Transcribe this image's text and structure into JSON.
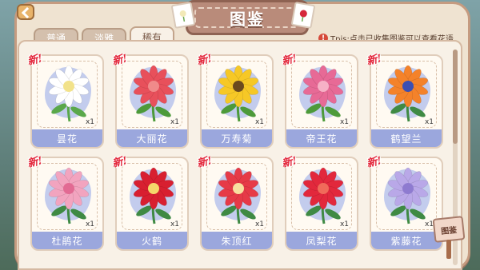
{
  "header": {
    "title": "图鉴"
  },
  "tabs": [
    {
      "label": "普通",
      "active": false
    },
    {
      "label": "淡雅",
      "active": false
    },
    {
      "label": "稀有",
      "active": true
    }
  ],
  "tip": {
    "icon": "exclamation-icon",
    "text": "Tpis:点击已收集图鉴可以查看花语"
  },
  "new_badge_text": "新!",
  "flowers": [
    {
      "name": "昙花",
      "count": "x1",
      "petal": "#ffffff",
      "center": "#f2e28a",
      "stem": "#5aa84a"
    },
    {
      "name": "大丽花",
      "count": "x1",
      "petal": "#e8505b",
      "center": "#f08a8a",
      "stem": "#4d9a3a"
    },
    {
      "name": "万寿菊",
      "count": "x1",
      "petal": "#f6c826",
      "center": "#6b4a1e",
      "stem": "#4d9a3a"
    },
    {
      "name": "帝王花",
      "count": "x1",
      "petal": "#e76a96",
      "center": "#f6b1c6",
      "stem": "#4d9a3a"
    },
    {
      "name": "鹤望兰",
      "count": "x1",
      "petal": "#f4822a",
      "center": "#3b4fb3",
      "stem": "#3f8a44"
    },
    {
      "name": "杜鹃花",
      "count": "x1",
      "petal": "#f2a4bf",
      "center": "#e26a93",
      "stem": "#3f8a44"
    },
    {
      "name": "火鹤",
      "count": "x1",
      "petal": "#d81f30",
      "center": "#f5d76a",
      "stem": "#3f8a44"
    },
    {
      "name": "朱顶红",
      "count": "x1",
      "petal": "#e63a47",
      "center": "#f8e0a0",
      "stem": "#3f8a44"
    },
    {
      "name": "凤梨花",
      "count": "x1",
      "petal": "#e2283c",
      "center": "#f06b5a",
      "stem": "#3f8a44"
    },
    {
      "name": "紫藤花",
      "count": "x1",
      "petal": "#b9a8e8",
      "center": "#8e7bd0",
      "stem": "#3f8a44"
    }
  ],
  "book_button": {
    "label": "图鉴"
  },
  "colors": {
    "panel": "#efe3d1",
    "name_bar": "#9ba7dd",
    "new_badge": "#e3263a"
  }
}
